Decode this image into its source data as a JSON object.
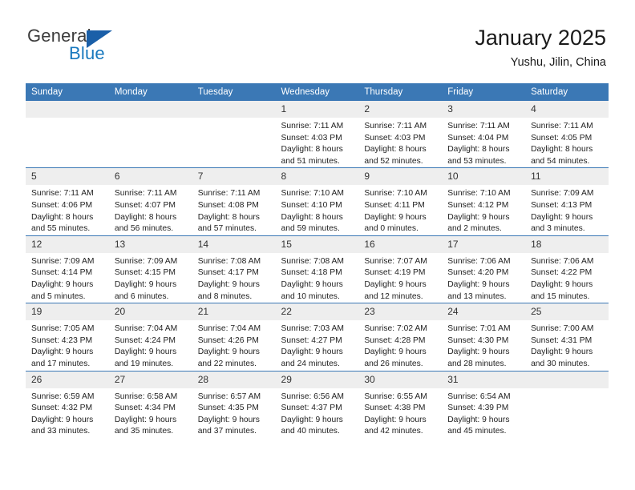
{
  "brand": {
    "name_part1": "General",
    "name_part2": "Blue",
    "triangle_icon": "blue-triangle-icon",
    "accent_color": "#1878be",
    "header_color": "#3b78b5"
  },
  "header": {
    "title": "January 2025",
    "subtitle": "Yushu, Jilin, China"
  },
  "calendar": {
    "weekday_headers": [
      "Sunday",
      "Monday",
      "Tuesday",
      "Wednesday",
      "Thursday",
      "Friday",
      "Saturday"
    ],
    "weeks": [
      [
        {
          "day": "",
          "empty": true,
          "sunrise": "",
          "sunset": "",
          "daylight_line1": "",
          "daylight_line2": ""
        },
        {
          "day": "",
          "empty": true,
          "sunrise": "",
          "sunset": "",
          "daylight_line1": "",
          "daylight_line2": ""
        },
        {
          "day": "",
          "empty": true,
          "sunrise": "",
          "sunset": "",
          "daylight_line1": "",
          "daylight_line2": ""
        },
        {
          "day": "1",
          "empty": false,
          "sunrise": "Sunrise: 7:11 AM",
          "sunset": "Sunset: 4:03 PM",
          "daylight_line1": "Daylight: 8 hours",
          "daylight_line2": "and 51 minutes."
        },
        {
          "day": "2",
          "empty": false,
          "sunrise": "Sunrise: 7:11 AM",
          "sunset": "Sunset: 4:03 PM",
          "daylight_line1": "Daylight: 8 hours",
          "daylight_line2": "and 52 minutes."
        },
        {
          "day": "3",
          "empty": false,
          "sunrise": "Sunrise: 7:11 AM",
          "sunset": "Sunset: 4:04 PM",
          "daylight_line1": "Daylight: 8 hours",
          "daylight_line2": "and 53 minutes."
        },
        {
          "day": "4",
          "empty": false,
          "sunrise": "Sunrise: 7:11 AM",
          "sunset": "Sunset: 4:05 PM",
          "daylight_line1": "Daylight: 8 hours",
          "daylight_line2": "and 54 minutes."
        }
      ],
      [
        {
          "day": "5",
          "empty": false,
          "sunrise": "Sunrise: 7:11 AM",
          "sunset": "Sunset: 4:06 PM",
          "daylight_line1": "Daylight: 8 hours",
          "daylight_line2": "and 55 minutes."
        },
        {
          "day": "6",
          "empty": false,
          "sunrise": "Sunrise: 7:11 AM",
          "sunset": "Sunset: 4:07 PM",
          "daylight_line1": "Daylight: 8 hours",
          "daylight_line2": "and 56 minutes."
        },
        {
          "day": "7",
          "empty": false,
          "sunrise": "Sunrise: 7:11 AM",
          "sunset": "Sunset: 4:08 PM",
          "daylight_line1": "Daylight: 8 hours",
          "daylight_line2": "and 57 minutes."
        },
        {
          "day": "8",
          "empty": false,
          "sunrise": "Sunrise: 7:10 AM",
          "sunset": "Sunset: 4:10 PM",
          "daylight_line1": "Daylight: 8 hours",
          "daylight_line2": "and 59 minutes."
        },
        {
          "day": "9",
          "empty": false,
          "sunrise": "Sunrise: 7:10 AM",
          "sunset": "Sunset: 4:11 PM",
          "daylight_line1": "Daylight: 9 hours",
          "daylight_line2": "and 0 minutes."
        },
        {
          "day": "10",
          "empty": false,
          "sunrise": "Sunrise: 7:10 AM",
          "sunset": "Sunset: 4:12 PM",
          "daylight_line1": "Daylight: 9 hours",
          "daylight_line2": "and 2 minutes."
        },
        {
          "day": "11",
          "empty": false,
          "sunrise": "Sunrise: 7:09 AM",
          "sunset": "Sunset: 4:13 PM",
          "daylight_line1": "Daylight: 9 hours",
          "daylight_line2": "and 3 minutes."
        }
      ],
      [
        {
          "day": "12",
          "empty": false,
          "sunrise": "Sunrise: 7:09 AM",
          "sunset": "Sunset: 4:14 PM",
          "daylight_line1": "Daylight: 9 hours",
          "daylight_line2": "and 5 minutes."
        },
        {
          "day": "13",
          "empty": false,
          "sunrise": "Sunrise: 7:09 AM",
          "sunset": "Sunset: 4:15 PM",
          "daylight_line1": "Daylight: 9 hours",
          "daylight_line2": "and 6 minutes."
        },
        {
          "day": "14",
          "empty": false,
          "sunrise": "Sunrise: 7:08 AM",
          "sunset": "Sunset: 4:17 PM",
          "daylight_line1": "Daylight: 9 hours",
          "daylight_line2": "and 8 minutes."
        },
        {
          "day": "15",
          "empty": false,
          "sunrise": "Sunrise: 7:08 AM",
          "sunset": "Sunset: 4:18 PM",
          "daylight_line1": "Daylight: 9 hours",
          "daylight_line2": "and 10 minutes."
        },
        {
          "day": "16",
          "empty": false,
          "sunrise": "Sunrise: 7:07 AM",
          "sunset": "Sunset: 4:19 PM",
          "daylight_line1": "Daylight: 9 hours",
          "daylight_line2": "and 12 minutes."
        },
        {
          "day": "17",
          "empty": false,
          "sunrise": "Sunrise: 7:06 AM",
          "sunset": "Sunset: 4:20 PM",
          "daylight_line1": "Daylight: 9 hours",
          "daylight_line2": "and 13 minutes."
        },
        {
          "day": "18",
          "empty": false,
          "sunrise": "Sunrise: 7:06 AM",
          "sunset": "Sunset: 4:22 PM",
          "daylight_line1": "Daylight: 9 hours",
          "daylight_line2": "and 15 minutes."
        }
      ],
      [
        {
          "day": "19",
          "empty": false,
          "sunrise": "Sunrise: 7:05 AM",
          "sunset": "Sunset: 4:23 PM",
          "daylight_line1": "Daylight: 9 hours",
          "daylight_line2": "and 17 minutes."
        },
        {
          "day": "20",
          "empty": false,
          "sunrise": "Sunrise: 7:04 AM",
          "sunset": "Sunset: 4:24 PM",
          "daylight_line1": "Daylight: 9 hours",
          "daylight_line2": "and 19 minutes."
        },
        {
          "day": "21",
          "empty": false,
          "sunrise": "Sunrise: 7:04 AM",
          "sunset": "Sunset: 4:26 PM",
          "daylight_line1": "Daylight: 9 hours",
          "daylight_line2": "and 22 minutes."
        },
        {
          "day": "22",
          "empty": false,
          "sunrise": "Sunrise: 7:03 AM",
          "sunset": "Sunset: 4:27 PM",
          "daylight_line1": "Daylight: 9 hours",
          "daylight_line2": "and 24 minutes."
        },
        {
          "day": "23",
          "empty": false,
          "sunrise": "Sunrise: 7:02 AM",
          "sunset": "Sunset: 4:28 PM",
          "daylight_line1": "Daylight: 9 hours",
          "daylight_line2": "and 26 minutes."
        },
        {
          "day": "24",
          "empty": false,
          "sunrise": "Sunrise: 7:01 AM",
          "sunset": "Sunset: 4:30 PM",
          "daylight_line1": "Daylight: 9 hours",
          "daylight_line2": "and 28 minutes."
        },
        {
          "day": "25",
          "empty": false,
          "sunrise": "Sunrise: 7:00 AM",
          "sunset": "Sunset: 4:31 PM",
          "daylight_line1": "Daylight: 9 hours",
          "daylight_line2": "and 30 minutes."
        }
      ],
      [
        {
          "day": "26",
          "empty": false,
          "sunrise": "Sunrise: 6:59 AM",
          "sunset": "Sunset: 4:32 PM",
          "daylight_line1": "Daylight: 9 hours",
          "daylight_line2": "and 33 minutes."
        },
        {
          "day": "27",
          "empty": false,
          "sunrise": "Sunrise: 6:58 AM",
          "sunset": "Sunset: 4:34 PM",
          "daylight_line1": "Daylight: 9 hours",
          "daylight_line2": "and 35 minutes."
        },
        {
          "day": "28",
          "empty": false,
          "sunrise": "Sunrise: 6:57 AM",
          "sunset": "Sunset: 4:35 PM",
          "daylight_line1": "Daylight: 9 hours",
          "daylight_line2": "and 37 minutes."
        },
        {
          "day": "29",
          "empty": false,
          "sunrise": "Sunrise: 6:56 AM",
          "sunset": "Sunset: 4:37 PM",
          "daylight_line1": "Daylight: 9 hours",
          "daylight_line2": "and 40 minutes."
        },
        {
          "day": "30",
          "empty": false,
          "sunrise": "Sunrise: 6:55 AM",
          "sunset": "Sunset: 4:38 PM",
          "daylight_line1": "Daylight: 9 hours",
          "daylight_line2": "and 42 minutes."
        },
        {
          "day": "31",
          "empty": false,
          "sunrise": "Sunrise: 6:54 AM",
          "sunset": "Sunset: 4:39 PM",
          "daylight_line1": "Daylight: 9 hours",
          "daylight_line2": "and 45 minutes."
        },
        {
          "day": "",
          "empty": true,
          "sunrise": "",
          "sunset": "",
          "daylight_line1": "",
          "daylight_line2": ""
        }
      ]
    ]
  }
}
